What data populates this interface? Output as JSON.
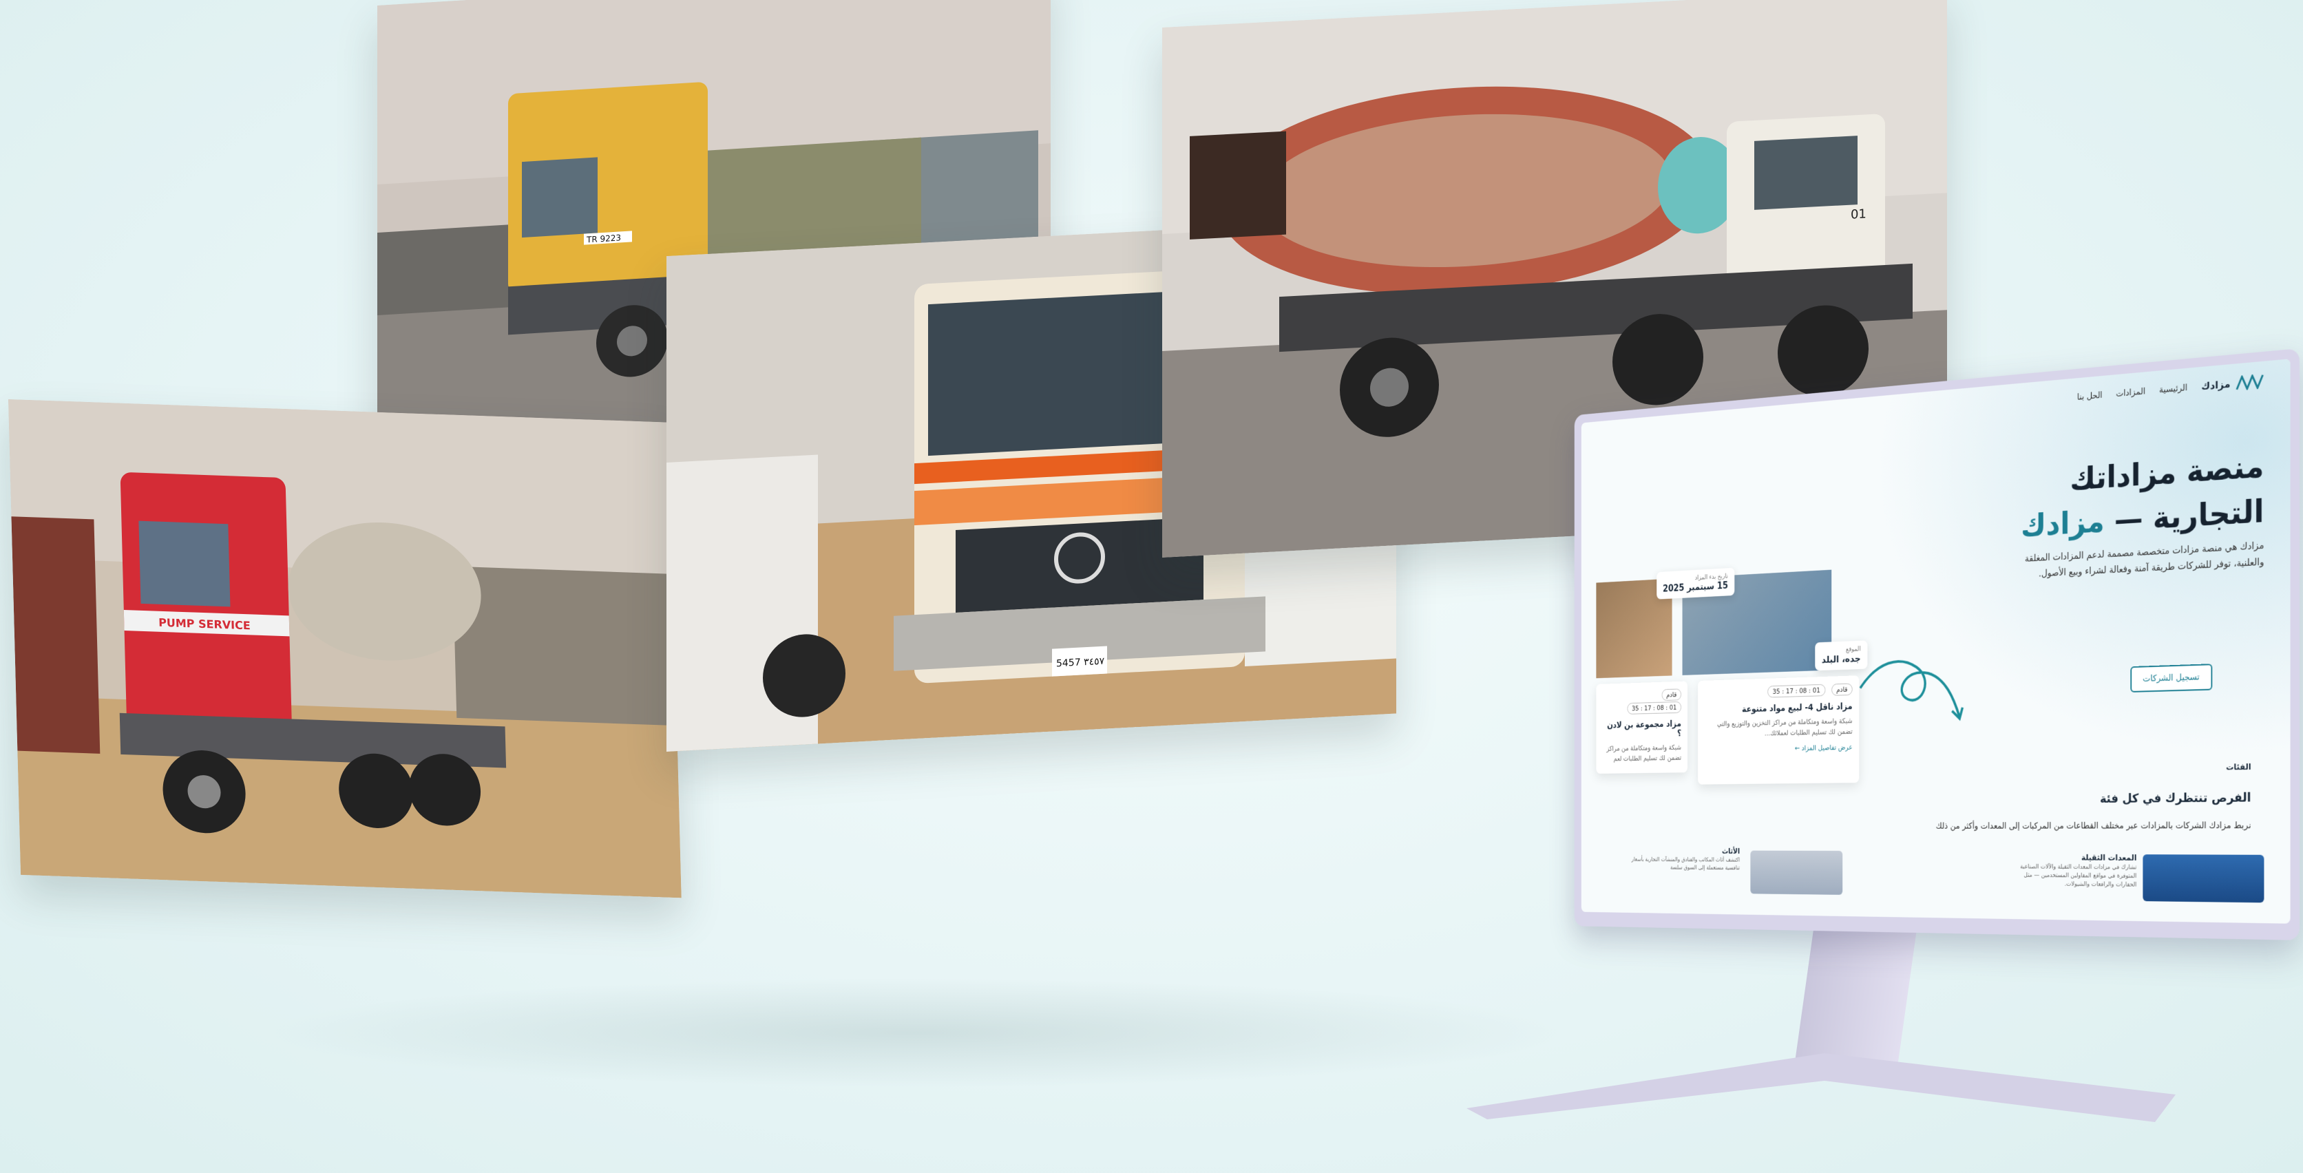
{
  "site": {
    "logo_text": "مزادك",
    "nav": [
      "الرئيسية",
      "المزادات",
      "الحل بنا"
    ]
  },
  "hero": {
    "title_line1": "منصة مزاداتك",
    "title_line2_prefix": "التجارية — ",
    "title_line2_accent": "مزادك",
    "description": "مزادك هي منصة مزادات متخصصة مصممة لدعم المزادات المغلقة والعلنية، توفر للشركات طريقة آمنة وفعالة لشراء وبيع الأصول.",
    "register_button": "تسجيل الشركات"
  },
  "date_badge": {
    "label": "تاريخ بدء المزاد",
    "value": "15 سبتمبر 2025"
  },
  "location_badge": {
    "label": "الموقع",
    "value": "جده، البلد"
  },
  "auctions": [
    {
      "status": "قادم",
      "timer": "01 : 08 : 17 : 35",
      "title": "مزاد ناقل 4- لبيع مواد متنوعة",
      "description": "شبكة واسعة ومتكاملة من مراكز التخزين والتوزيع والتي تضمن لك تسليم الطلبات لعملائك...",
      "link": "عرض تفاصيل المزاد"
    },
    {
      "status": "قادم",
      "timer": "01 : 08 : 17 : 35",
      "title": "مزاد مجموعة بن لادن ؟",
      "description": "شبكة واسعة ومتكاملة من مراكز تضمن لك تسليم الطلبات لعم"
    }
  ],
  "categories_section": {
    "tag": "الفئات",
    "title": "الفرص تنتظرك في كل فئة",
    "description": "نربط مزادك الشركات بالمزادات عبر مختلف القطاعات من المركبات إلى المعدات وأكثر من ذلك",
    "items": [
      {
        "title": "المعدات الثقيلة",
        "description": "تشارك في مزادات المعدات الثقيلة والآلات الصناعية المتوفرة في مواقع المقاولين المستخدمين — مثل الحفارات والرافعات والشيولات."
      },
      {
        "title": "الأثاث",
        "description": "اكتشف أثاث المكاتب والفنادق والمنشآت التجارية بأسعار تنافسية مستعملة إلى السوق سلسة"
      }
    ]
  },
  "photos": {
    "truck_yellow_plate": "TR 9223",
    "red_truck_text": "PUMP SERVICE",
    "white_truck_plate": "5457 ٣٤٥٧",
    "mixer_plate": "01"
  },
  "colors": {
    "accent": "#1d7f93",
    "monitor": "#d8d5ea",
    "background": "#e6f4f5"
  }
}
